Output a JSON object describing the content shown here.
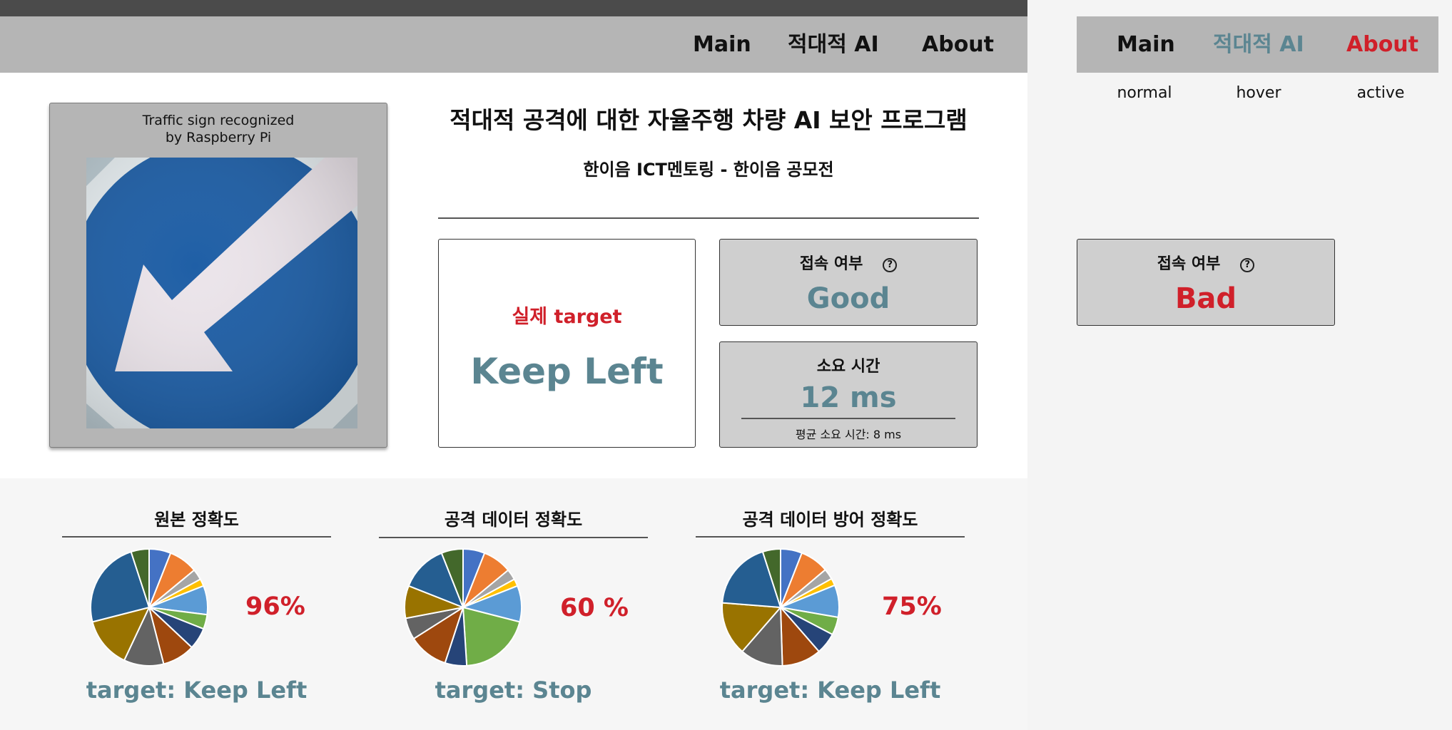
{
  "nav": {
    "items": [
      "Main",
      "적대적 AI",
      "About"
    ]
  },
  "sign_card": {
    "caption_line1": "Traffic sign recognized",
    "caption_line2": "by Raspberry Pi",
    "image_icon": "keep-left-sign-icon"
  },
  "header": {
    "title": "적대적 공격에 대한 자율주행 차량 AI 보안 프로그램",
    "subtitle": "한이음 ICT멘토링 - 한이음 공모전"
  },
  "target": {
    "label": "실제 target",
    "value": "Keep Left"
  },
  "connection": {
    "title": "접속 여부",
    "help_icon": "?",
    "value": "Good"
  },
  "latency": {
    "title": "소요 시간",
    "value": "12 ms",
    "average": "평균 소요 시간: 8 ms"
  },
  "accuracy": [
    {
      "title": "원본 정확도",
      "percent": "96%",
      "target": "target: Keep Left"
    },
    {
      "title": "공격 데이터 정확도",
      "percent": "60 %",
      "target": "target: Stop"
    },
    {
      "title": "공격 데이터 방어 정확도",
      "percent": "75%",
      "target": "target: Keep Left"
    }
  ],
  "demo": {
    "nav_items": [
      "Main",
      "적대적 AI",
      "About"
    ],
    "states": [
      "normal",
      "hover",
      "active"
    ],
    "connection_title": "접속 여부",
    "connection_help_icon": "?",
    "connection_value": "Bad"
  },
  "colors": {
    "accent_teal": "#5b8591",
    "accent_red": "#d0202a",
    "nav_bg": "#b5b5b5",
    "card_bg": "#cfcfcf"
  },
  "chart_data": [
    {
      "type": "pie",
      "title": "원본 정확도",
      "values": [
        6,
        8,
        3,
        2,
        8,
        4,
        6,
        9,
        11,
        14,
        24,
        5
      ],
      "colors": [
        "#4472c4",
        "#ed7d31",
        "#a5a5a5",
        "#ffc000",
        "#5b9bd5",
        "#70ad47",
        "#264478",
        "#9e480e",
        "#636363",
        "#997300",
        "#255e91",
        "#43682b"
      ]
    },
    {
      "type": "pie",
      "title": "공격 데이터 정확도",
      "values": [
        6,
        8,
        3,
        2,
        10,
        20,
        6,
        11,
        6,
        9,
        13,
        6
      ],
      "colors": [
        "#4472c4",
        "#ed7d31",
        "#a5a5a5",
        "#ffc000",
        "#5b9bd5",
        "#70ad47",
        "#264478",
        "#9e480e",
        "#636363",
        "#997300",
        "#255e91",
        "#43682b"
      ]
    },
    {
      "type": "pie",
      "title": "공격 데이터 방어 정확도",
      "values": [
        6,
        8,
        3,
        2,
        9,
        5,
        6,
        11,
        12,
        15,
        19,
        5
      ],
      "colors": [
        "#4472c4",
        "#ed7d31",
        "#a5a5a5",
        "#ffc000",
        "#5b9bd5",
        "#70ad47",
        "#264478",
        "#9e480e",
        "#636363",
        "#997300",
        "#255e91",
        "#43682b"
      ]
    }
  ]
}
